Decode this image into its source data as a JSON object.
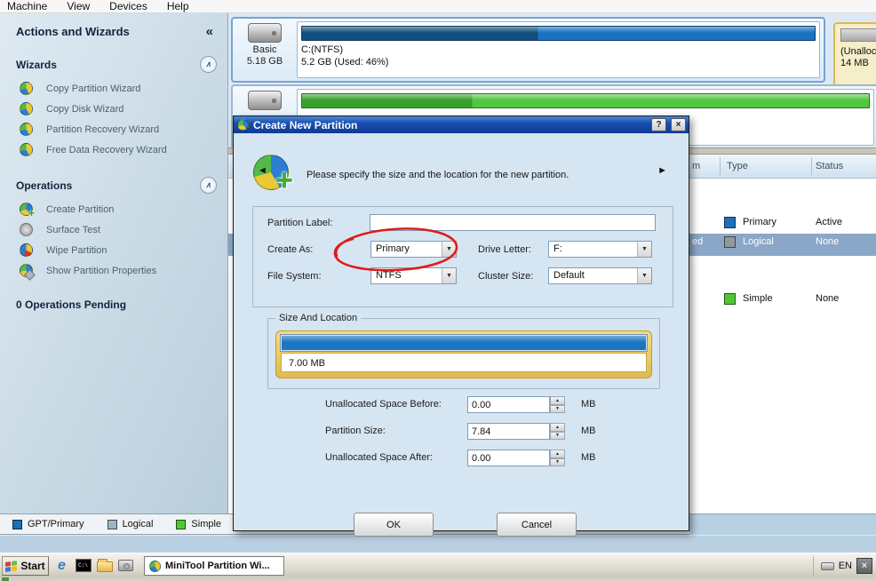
{
  "menubar": {
    "items": [
      "Machine",
      "View",
      "Devices",
      "Help"
    ]
  },
  "sidebar": {
    "title": "Actions and Wizards",
    "sections": [
      {
        "label": "Wizards",
        "items": [
          {
            "label": "Copy Partition Wizard"
          },
          {
            "label": "Copy Disk Wizard"
          },
          {
            "label": "Partition Recovery Wizard"
          },
          {
            "label": "Free Data Recovery Wizard"
          }
        ]
      },
      {
        "label": "Operations",
        "items": [
          {
            "label": "Create Partition"
          },
          {
            "label": "Surface Test"
          },
          {
            "label": "Wipe Partition"
          },
          {
            "label": "Show Partition Properties"
          }
        ]
      }
    ],
    "pending": "0 Operations Pending"
  },
  "diskmap": {
    "disk1": {
      "name": "Basic",
      "size": "5.18 GB",
      "partition_label": "C:(NTFS)",
      "partition_info": "5.2 GB (Used: 46%)"
    },
    "unallocated": {
      "label": "(Unalloca",
      "size": "14 MB"
    }
  },
  "table": {
    "header_fragment": "m",
    "headers": {
      "type": "Type",
      "status": "Status"
    },
    "rows": [
      {
        "fragment": "",
        "type": "Primary",
        "status": "Active",
        "color": "#1d6fb8"
      },
      {
        "fragment": "ed",
        "type": "Logical",
        "status": "None",
        "color": "#8e9aa0"
      },
      {
        "fragment": "",
        "type": "Simple",
        "status": "None",
        "color": "#4fc836"
      }
    ]
  },
  "dialog": {
    "title": "Create New Partition",
    "message": "Please specify the size and the location for the new partition.",
    "fields": {
      "partition_label": {
        "label": "Partition Label:",
        "value": ""
      },
      "create_as": {
        "label": "Create As:",
        "value": "Primary"
      },
      "drive_letter": {
        "label": "Drive Letter:",
        "value": "F:"
      },
      "file_system": {
        "label": "File System:",
        "value": "NTFS"
      },
      "cluster_size": {
        "label": "Cluster Size:",
        "value": "Default"
      }
    },
    "size_location": {
      "legend": "Size And Location",
      "slider_value": "7.00 MB",
      "spinners": [
        {
          "label": "Unallocated Space Before:",
          "value": "0.00",
          "unit": "MB"
        },
        {
          "label": "Partition Size:",
          "value": "7.84",
          "unit": "MB"
        },
        {
          "label": "Unallocated Space After:",
          "value": "0.00",
          "unit": "MB"
        }
      ]
    },
    "buttons": {
      "ok": "OK",
      "cancel": "Cancel"
    }
  },
  "legend": {
    "items": [
      {
        "label": "GPT/Primary",
        "color": "#1d6fb8"
      },
      {
        "label": "Logical",
        "color": "#9fb6c0"
      },
      {
        "label": "Simple",
        "color": "#4fc836"
      }
    ],
    "partial_color": "#e8930c"
  },
  "taskbar": {
    "start": "Start",
    "task_button": "MiniTool Partition Wi...",
    "tray_lang": "EN"
  },
  "icons": {
    "collapse": "«",
    "chevron_up": "∧",
    "dropdown_arrow": "▼",
    "spin_up": "▲",
    "spin_down": "▼",
    "slider_left": "◄",
    "slider_right": "►",
    "help": "?",
    "close": "×",
    "cmd": "C:\\",
    "ie": "e",
    "tray_close": "×"
  },
  "colors": {
    "used_blue": "#134e7d",
    "free_blue": "#1b72c2",
    "used_green": "#37a02c",
    "free_green": "#55c63e",
    "selected_row": "#8ba7c7",
    "annotation_red": "#e01b1b"
  }
}
